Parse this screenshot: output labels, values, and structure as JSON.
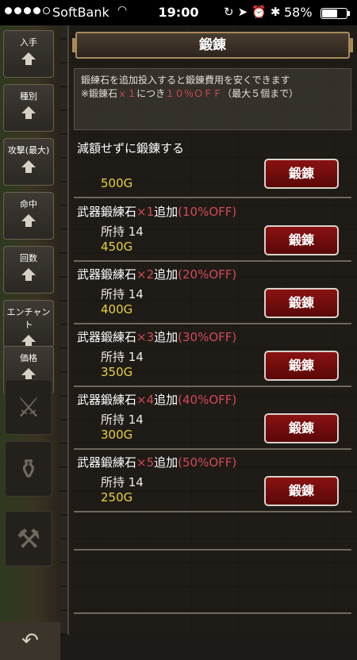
{
  "status_bar": {
    "carrier": "SoftBank",
    "time": "19:00",
    "battery": "58%",
    "battery_level": 0.58
  },
  "sidebar": {
    "items": [
      {
        "label": "入手"
      },
      {
        "label": "種別"
      },
      {
        "label": "攻撃(最大)"
      },
      {
        "label": "命中"
      },
      {
        "label": "回数"
      },
      {
        "label": "エンチャント"
      },
      {
        "label": "価格"
      }
    ],
    "deco_icons": [
      "crossed-swords-icon",
      "vase-icon",
      "anvil-icon"
    ],
    "back_icon": "back-arrow-icon"
  },
  "panel": {
    "title": "鍛錬",
    "notice": {
      "line1": "鍛練石を追加投入すると鍛錬費用を安くできます",
      "line2_prefix": "※鍛錬石",
      "line2_red1": "ｘ１",
      "line2_mid": "につき",
      "line2_red2": "１０％ＯＦＦ",
      "line2_suffix": "（最大５個まで）"
    },
    "options": [
      {
        "name": "減額せずに鍛錬する",
        "name_red": "",
        "owned": "",
        "price": "500G",
        "button": "鍛錬"
      },
      {
        "name": "武器鍛練石",
        "name_red": "×1",
        "name_mid": "追加",
        "name_pct": "(10%OFF)",
        "owned": "所持 14",
        "price": "450G",
        "button": "鍛錬"
      },
      {
        "name": "武器鍛練石",
        "name_red": "×2",
        "name_mid": "追加",
        "name_pct": "(20%OFF)",
        "owned": "所持 14",
        "price": "400G",
        "button": "鍛錬"
      },
      {
        "name": "武器鍛練石",
        "name_red": "×3",
        "name_mid": "追加",
        "name_pct": "(30%OFF)",
        "owned": "所持 14",
        "price": "350G",
        "button": "鍛錬"
      },
      {
        "name": "武器鍛練石",
        "name_red": "×4",
        "name_mid": "追加",
        "name_pct": "(40%OFF)",
        "owned": "所持 14",
        "price": "300G",
        "button": "鍛錬"
      },
      {
        "name": "武器鍛練石",
        "name_red": "×5",
        "name_mid": "追加",
        "name_pct": "(50%OFF)",
        "owned": "所持 14",
        "price": "250G",
        "button": "鍛錬"
      }
    ]
  },
  "colors": {
    "accent_red": "#d14a55",
    "price_yellow": "#e8d13f",
    "button_red": "#8a1212"
  }
}
